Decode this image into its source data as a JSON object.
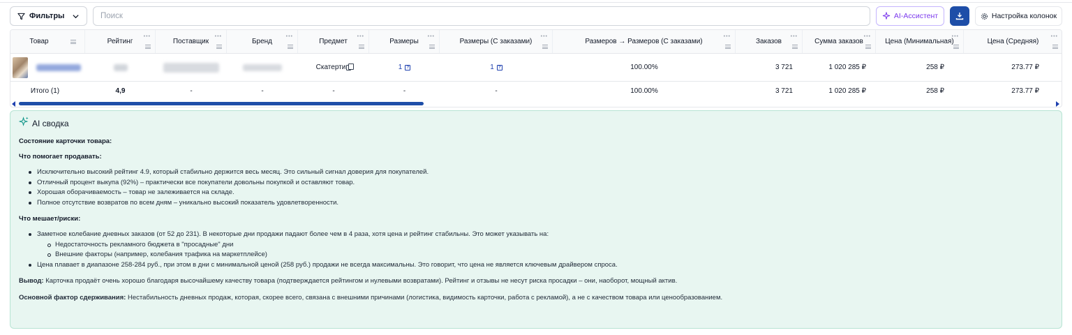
{
  "toolbar": {
    "filters_label": "Фильтры",
    "search_placeholder": "Поиск",
    "ai_assistant_label": "AI-Ассистент",
    "columns_label": "Настройка колонок"
  },
  "table": {
    "headers": [
      "Товар",
      "Рейтинг",
      "Поставщик",
      "Бренд",
      "Предмет",
      "Размеры",
      "Размеры (С заказами)",
      "Размеров → Размеров (С заказами)",
      "Заказов",
      "Сумма заказов",
      "Цена (Минимальная)",
      "Цена (Средняя)"
    ],
    "row": {
      "subject": "Скатерти",
      "sizes": "1",
      "sizes_with_orders": "1",
      "sizes_ratio": "100.00%",
      "orders": "3 721",
      "orders_sum": "1 020 285 ₽",
      "price_min": "258 ₽",
      "price_avg": "273.77 ₽"
    },
    "total": {
      "label": "Итого (1)",
      "rating": "4,9",
      "supplier": "-",
      "brand": "-",
      "subject": "-",
      "sizes": "-",
      "sizes_with_orders": "-",
      "sizes_ratio": "100.00%",
      "orders": "3 721",
      "orders_sum": "1 020 285 ₽",
      "price_min": "258 ₽",
      "price_avg": "273.77 ₽"
    }
  },
  "ai_summary": {
    "title": "AI сводка",
    "card_state": "Состояние карточки товара:",
    "helps_title": "Что помогает продавать:",
    "helps": [
      "Исключительно высокий рейтинг 4.9, который стабильно держится весь месяц. Это сильный сигнал доверия для покупателей.",
      "Отличный процент выкупа (92%) – практически все покупатели довольны покупкой и оставляют товар.",
      "Хорошая оборачиваемость – товар не залеживается на складе.",
      "Полное отсутствие возвратов по всем дням – уникально высокий показатель удовлетворенности."
    ],
    "risks_title": "Что мешает/риски:",
    "risks": [
      "Заметное колебание дневных заказов (от 52 до 231). В некоторые дни продажи падают более чем в 4 раза, хотя цена и рейтинг стабильны. Это может указывать на:",
      "Цена плавает в диапазоне 258-284 руб., при этом в дни с минимальной ценой (258 руб.) продажи не всегда максимальны. Это говорит, что цена не является ключевым драйвером спроса."
    ],
    "risk_subitems": [
      "Недостаточность рекламного бюджета в \"просадные\" дни",
      "Внешние факторы (например, колебания трафика на маркетплейсе)"
    ],
    "conclusion_label": "Вывод:",
    "conclusion_text": "Карточка продаёт очень хорошо благодаря высочайшему качеству товара (подтверждается рейтингом и нулевыми возвратами). Рейтинг и отзывы не несут риска просадки – они, наоборот, мощный актив.",
    "constraint_label": "Основной фактор сдерживания:",
    "constraint_text": "Нестабильность дневных продаж, которая, скорее всего, связана с внешними причинами (логистика, видимость карточки, работа с рекламой), а не с качеством товара или ценообразованием."
  }
}
